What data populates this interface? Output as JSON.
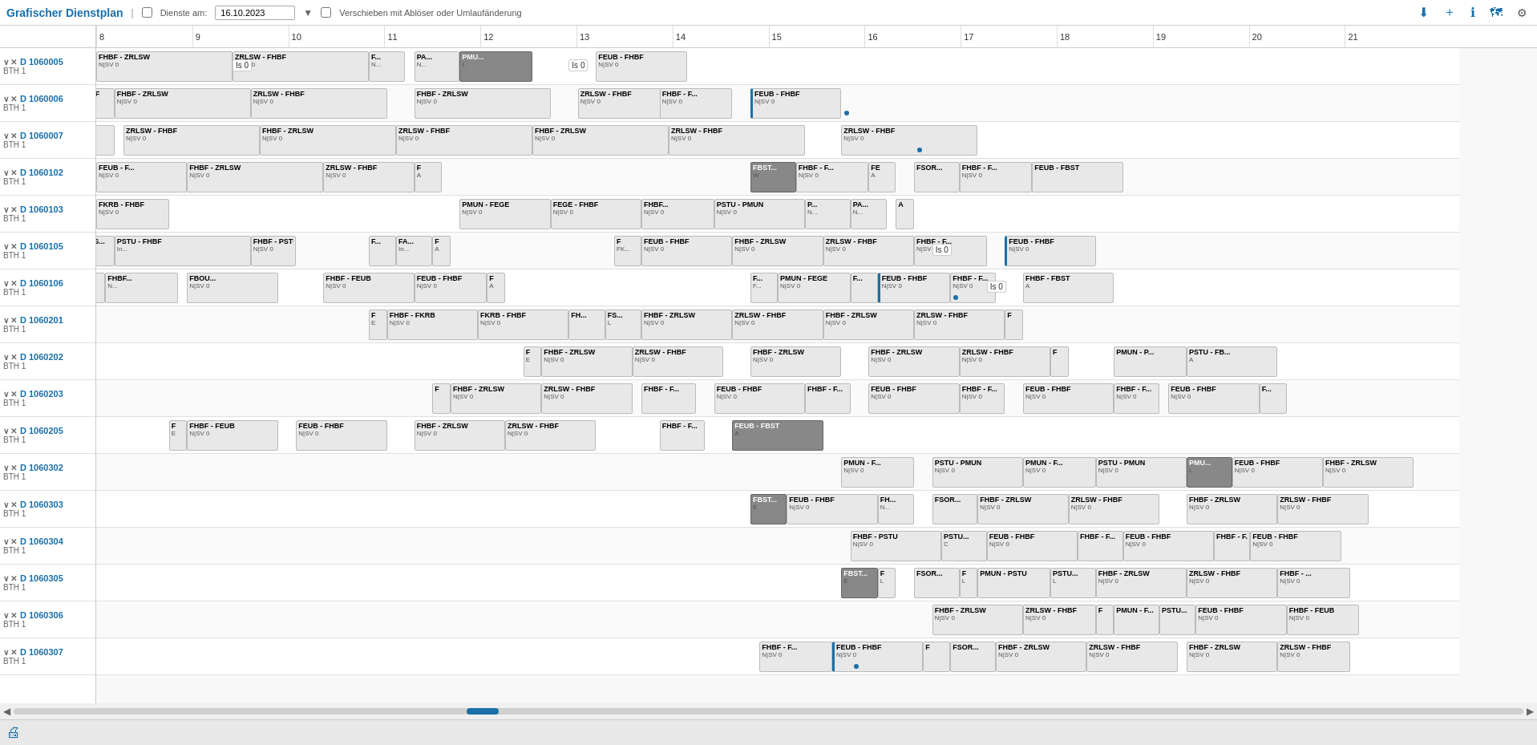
{
  "header": {
    "title": "Grafischer Dienstplan",
    "dienste_label": "Dienste am:",
    "date_value": "16.10.2023",
    "checkbox_label": "Verschieben mit Ablöser oder Umlaufänderung"
  },
  "timeline": {
    "hours": [
      8,
      9,
      10,
      11,
      12,
      13,
      14,
      15,
      16,
      17,
      18,
      19,
      20,
      21
    ]
  },
  "rows": [
    {
      "id": "D 1060005",
      "sub": "BTH 1"
    },
    {
      "id": "D 1060006",
      "sub": "BTH 1"
    },
    {
      "id": "D 1060007",
      "sub": "BTH 1"
    },
    {
      "id": "D 1060102",
      "sub": "BTH 1"
    },
    {
      "id": "D 1060103",
      "sub": "BTH 1"
    },
    {
      "id": "D 1060105",
      "sub": "BTH 1"
    },
    {
      "id": "D 1060106",
      "sub": "BTH 1"
    },
    {
      "id": "D 1060201",
      "sub": "BTH 1"
    },
    {
      "id": "D 1060202",
      "sub": "BTH 1"
    },
    {
      "id": "D 1060203",
      "sub": "BTH 1"
    },
    {
      "id": "D 1060205",
      "sub": "BTH 1"
    },
    {
      "id": "D 1060302",
      "sub": "BTH 1"
    },
    {
      "id": "D 1060303",
      "sub": "BTH 1"
    },
    {
      "id": "D 1060304",
      "sub": "BTH 1"
    },
    {
      "id": "D 1060305",
      "sub": "BTH 1"
    },
    {
      "id": "D 1060306",
      "sub": "BTH 1"
    },
    {
      "id": "D 1060307",
      "sub": "BTH 1"
    }
  ],
  "is0_labels": [
    {
      "text": "Is 0",
      "row": 0,
      "time_pct": 46
    },
    {
      "text": "Is 0",
      "row": 0,
      "time_pct": 15
    },
    {
      "text": "Is 0",
      "row": 5,
      "time_pct": 66
    },
    {
      "text": "Is 0",
      "row": 6,
      "time_pct": 78
    }
  ],
  "icons": {
    "download": "⬇",
    "add": "+",
    "info": "ℹ",
    "map": "🗺",
    "settings": "⚙",
    "chevron_down": "∨",
    "close": "✕",
    "print": "🖨",
    "arrow_left": "◀",
    "arrow_right": "▶"
  }
}
